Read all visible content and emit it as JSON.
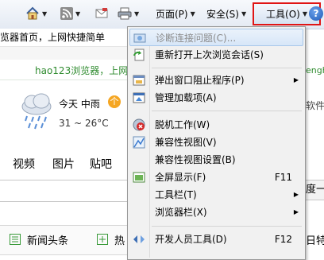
{
  "toolbar": {
    "page_label": "页面(P)",
    "safety_label": "安全(S)",
    "tools_label": "工具(O)",
    "help_icon_text": "?"
  },
  "page": {
    "favorites_text": "览器首页，上网快捷简单",
    "hao_text": "hao123浏览器，上网",
    "weather_today": "今天 中雨",
    "weather_temp": "31 ~ 26°C",
    "nav_items": [
      "视频",
      "图片",
      "贴吧"
    ],
    "news_label": "新闻头条",
    "hot_label": "热",
    "right_fragments": {
      "top": "engh",
      "mid": "软件",
      "search": "度一",
      "bottom": "日特"
    }
  },
  "menu": {
    "items": [
      {
        "label": "诊断连接问题(C)...",
        "disabled": true,
        "icon": "diagnose-icon"
      },
      {
        "label": "重新打开上次浏览会话(S)",
        "icon": "reopen-session-icon"
      },
      {
        "label": "弹出窗口阻止程序(P)",
        "submenu": true,
        "icon": "popup-blocker-icon"
      },
      {
        "label": "管理加载项(A)",
        "icon": "addons-icon"
      },
      {
        "label": "脱机工作(W)",
        "icon": "offline-icon"
      },
      {
        "label": "兼容性视图(V)",
        "icon": "compat-view-icon"
      },
      {
        "label": "兼容性视图设置(B)",
        "icon": ""
      },
      {
        "label": "全屏显示(F)",
        "shortcut": "F11",
        "icon": "fullscreen-icon"
      },
      {
        "label": "工具栏(T)",
        "submenu": true,
        "icon": ""
      },
      {
        "label": "浏览器栏(X)",
        "submenu": true,
        "icon": ""
      },
      {
        "label": "开发人员工具(D)",
        "shortcut": "F12",
        "icon": "dev-tools-icon"
      }
    ]
  },
  "colors": {
    "highlight_border": "#e01515",
    "green_text": "#2e8b2e",
    "menu_bg": "#f1f1f1"
  }
}
